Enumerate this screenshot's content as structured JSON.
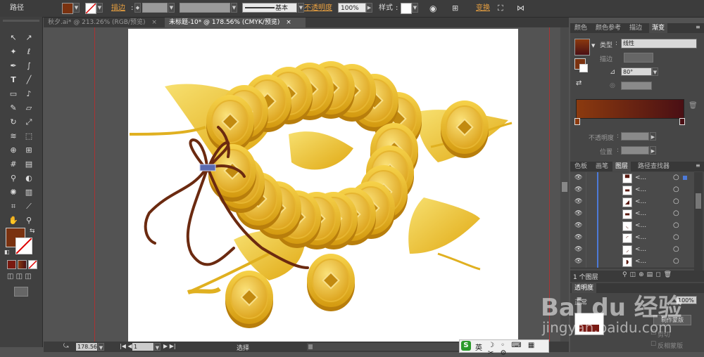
{
  "control_bar": {
    "path_label": "路径",
    "stroke_label": "描边",
    "stroke_style": "基本",
    "opacity_label": "不透明度",
    "opacity_value": "100%",
    "style_label": "样式",
    "transform_label": "变换"
  },
  "doc_tabs": [
    {
      "label": "秋夕.ai* @ 213.26% (RGB/预览)"
    },
    {
      "label": "未标题-10* @ 178.56% (CMYK/预览)"
    }
  ],
  "status_bar": {
    "zoom": "178.56",
    "page": "1",
    "tool_name": "选择"
  },
  "panels": {
    "top_tabs": [
      "颜色",
      "颜色参考",
      "描边",
      "渐变"
    ],
    "gradient": {
      "type_label": "类型",
      "type_value": "线性",
      "stroke_label": "描边",
      "angle_value": "80°",
      "opacity_label": "不透明度",
      "position_label": "位置"
    },
    "layer_tabs": [
      "色板",
      "画笔",
      "图层",
      "路径查找器"
    ],
    "layer_count": "1 个图层",
    "layer_row_label": "<...",
    "transparency_tab": "透明度",
    "mode_fragment": "正常",
    "opacity_fragment": "100%",
    "make_mask": "制作蒙版",
    "clip": "剪切",
    "invert_mask": "反相蒙版"
  },
  "ime_bar": {
    "lang": "英"
  },
  "watermark": {
    "brand": "Bai du 经验",
    "url": "jingyan.baidu.com"
  },
  "colors": {
    "fill_brown": "#7a3210",
    "gradient_start": "#8b3a0f",
    "gradient_end": "#4a0f14",
    "coin_gold": "#e8b51a",
    "leaf_gold": "#f0c830",
    "cord": "#6b2a10"
  }
}
